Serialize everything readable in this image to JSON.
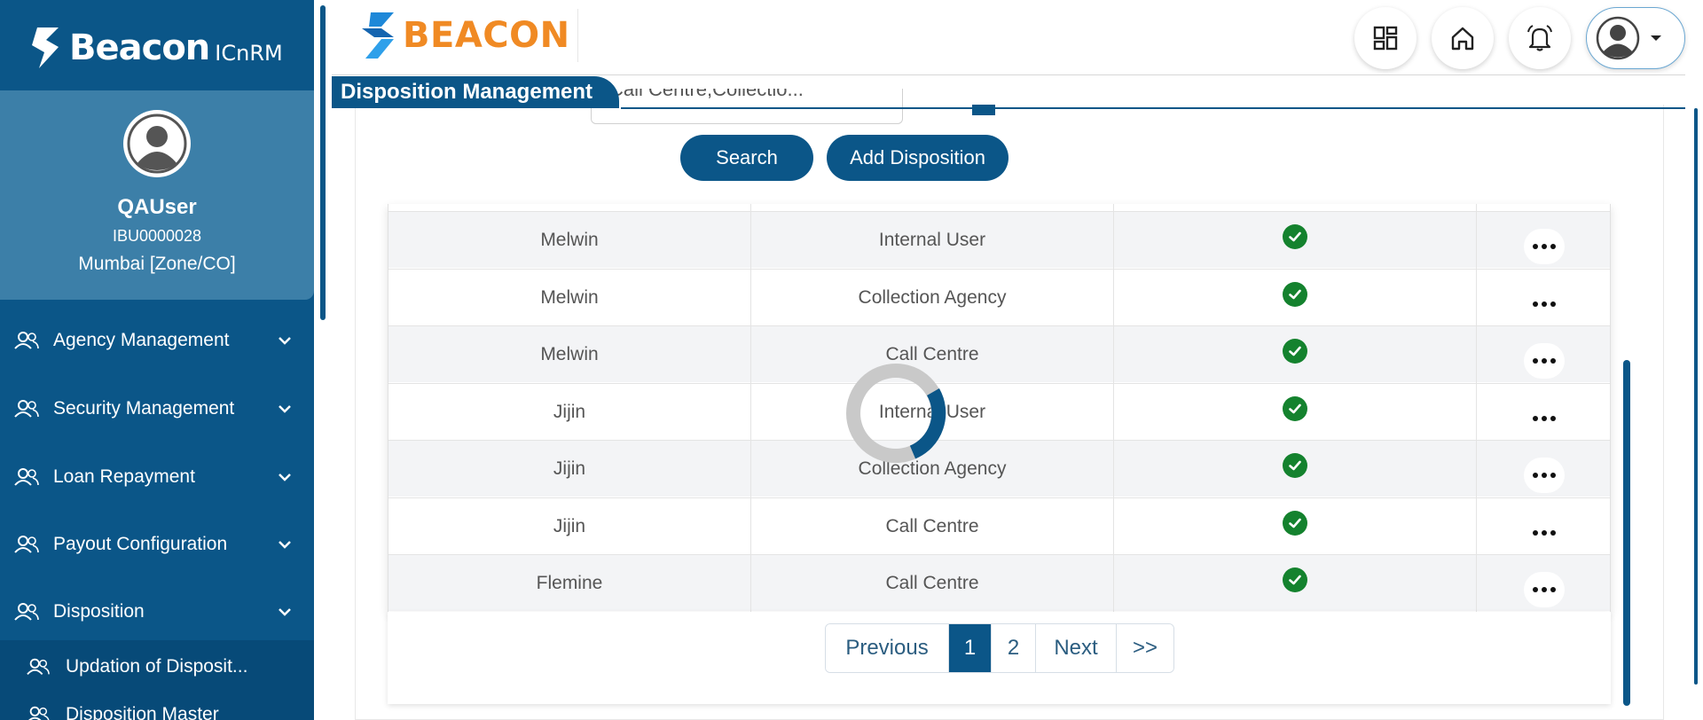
{
  "colors": {
    "primary": "#0b5688",
    "profile_bg": "#3c7fa8",
    "accent_orange": "#f08a24",
    "success": "#14822e"
  },
  "sidebar": {
    "brand": {
      "name": "Beacon",
      "sub": "ICnRM"
    },
    "profile": {
      "name": "QAUser",
      "code": "IBU0000028",
      "zone": "Mumbai [Zone/CO]"
    },
    "nav": [
      {
        "label": "Agency Management",
        "icon": "users-icon"
      },
      {
        "label": "Security Management",
        "icon": "users-icon"
      },
      {
        "label": "Loan Repayment",
        "icon": "users-icon"
      },
      {
        "label": "Payout Configuration",
        "icon": "users-icon"
      },
      {
        "label": "Disposition",
        "icon": "users-icon"
      }
    ],
    "sub_nav": [
      {
        "label": "Updation of Disposit...",
        "icon": "users-icon"
      },
      {
        "label": "Disposition Master",
        "icon": "users-icon"
      }
    ]
  },
  "header": {
    "logo_text": "BEACON",
    "icons": [
      "dashboard-icon",
      "home-icon",
      "bell-icon",
      "user-avatar-icon"
    ]
  },
  "page": {
    "title": "Disposition Management",
    "filter_value": "Call Centre,Collectio...",
    "buttons": {
      "search": "Search",
      "add": "Add Disposition"
    }
  },
  "table": {
    "rows": [
      {
        "name": "Melwin",
        "type": "Internal User",
        "active": true
      },
      {
        "name": "Melwin",
        "type": "Collection Agency",
        "active": true
      },
      {
        "name": "Melwin",
        "type": "Call Centre",
        "active": true
      },
      {
        "name": "Jijin",
        "type": "Internal User",
        "active": true
      },
      {
        "name": "Jijin",
        "type": "Collection Agency",
        "active": true
      },
      {
        "name": "Jijin",
        "type": "Call Centre",
        "active": true
      },
      {
        "name": "Flemine",
        "type": "Call Centre",
        "active": true
      }
    ]
  },
  "pagination": {
    "previous": "Previous",
    "pages": [
      "1",
      "2"
    ],
    "current": "1",
    "next": "Next",
    "last": ">>"
  }
}
